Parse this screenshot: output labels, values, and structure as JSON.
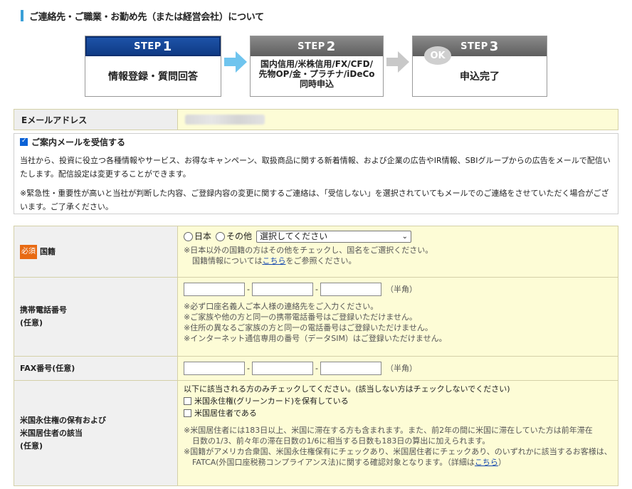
{
  "section_title": "ご連絡先・ご職業・お勤め先（または経営会社）について",
  "steps": [
    {
      "label": "STEP",
      "num": "1",
      "text": "情報登録・質問回答"
    },
    {
      "label": "STEP",
      "num": "2",
      "text_lines": [
        "国内信用/米株信用/FX/CFD/",
        "先物OP/金・プラチナ/iDeCo",
        "同時申込"
      ]
    },
    {
      "label": "STEP",
      "num": "3",
      "text": "申込完了",
      "badge": "OK"
    }
  ],
  "email": {
    "label": "Eメールアドレス"
  },
  "mail_opt": {
    "checkbox_label": "ご案内メールを受信する",
    "checked": true,
    "p1": "当社から、投資に役立つ各種情報やサービス、お得なキャンペーン、取扱商品に関する新着情報、および企業の広告やIR情報、SBIグループからの広告をメールで配信いたします。配信設定は変更することができます。",
    "p2": "※緊急性・重要性が高いと当社が判断した内容、ご登録内容の変更に関するご連絡は、「受信しない」を選択されていてもメールでのご連絡をさせていただく場合がございます。ご了承ください。"
  },
  "nationality": {
    "required_badge": "必須",
    "label": "国籍",
    "opt_japan": "日本",
    "opt_other": "その他",
    "select_value": "選択してください",
    "note1": "※日本以外の国籍の方はその他をチェックし、国名をご選択ください。",
    "note2_prefix": "国籍情報については",
    "note2_link": "こちら",
    "note2_suffix": "をご参照ください。"
  },
  "mobile": {
    "label_line1": "携帯電話番号",
    "label_line2": "(任意)",
    "hint": "（半角）",
    "notes": [
      "※必ず口座名義人ご本人様の連絡先をご入力ください。",
      "※ご家族や他の方と同一の携帯電話番号はご登録いただけません。",
      "※住所の異なるご家族の方と同一の電話番号はご登録いただけません。",
      "※インターネット通信専用の番号（データSIM）はご登録いただけません。"
    ]
  },
  "fax": {
    "label": "FAX番号(任意)",
    "hint": "（半角）"
  },
  "us": {
    "label_line1": "米国永住権の保有および",
    "label_line2": "米国居住者の該当",
    "label_line3": "(任意)",
    "intro": "以下に該当される方のみチェックしてください。(該当しない方はチェックしないでください)",
    "cb1": "米国永住権(グリーンカード)を保有している",
    "cb2": "米国居住者である",
    "note1_l1": "※米国居住者には183日以上、米国に滞在する方も含まれます。また、前2年の間に米国に滞在していた方は前年滞在",
    "note1_l2": "日数の1/3、前々年の滞在日数の1/6に相当する日数も183日の算出に加えられます。",
    "note2_l1": "※国籍がアメリカ合衆国、米国永住権保有にチェックあり、米国居住者にチェックあり、のいずれかに該当するお客様は、",
    "note2_l2_prefix": "FATCA(外国口座税務コンプライアンス法)に関する確認対象となります。（詳細は",
    "note2_link": "こちら",
    "note2_l2_suffix": "）"
  },
  "colors": {
    "step_active": "#0f3b85",
    "step_inactive": "#6e6e6e",
    "required": "#e86a12",
    "field_bg": "#fdfcd6"
  }
}
